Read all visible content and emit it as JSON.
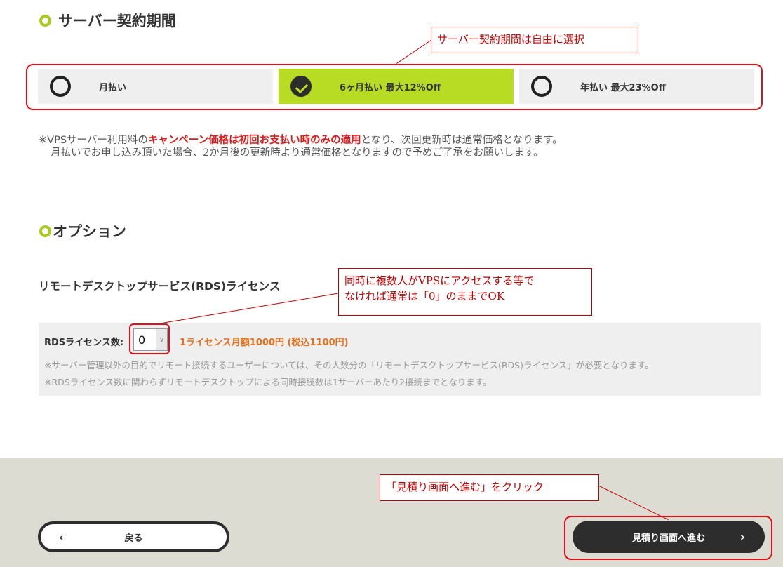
{
  "contract": {
    "title": "サーバー契約期間",
    "plans": [
      {
        "label": "月払い",
        "selected": false
      },
      {
        "label": "6ヶ月払い 最大12%Off",
        "selected": true
      },
      {
        "label": "年払い 最大23%Off",
        "selected": false
      }
    ],
    "callout": "サーバー契約期間は自由に選択"
  },
  "note": {
    "prefix": "※VPSサーバー利用料の",
    "highlight": "キャンペーン価格は初回お支払い時のみの適用",
    "suffix": "となり、次回更新時は通常価格となります。",
    "line2": "月払いでお申し込み頂いた場合、2か月後の更新時より通常価格となりますので予めご了承をお願いします。"
  },
  "option": {
    "title": "オプション",
    "rds_heading": "リモートデスクトップサービス(RDS)ライセンス",
    "rds_label": "RDSライセンス数:",
    "rds_value": "0",
    "rds_price": "1ライセンス月額1000円 (税込1100円)",
    "rds_note1": "※サーバー管理以外の目的でリモート接続するユーザーについては、その人数分の「リモートデスクトップサービス(RDS)ライセンス」が必要となります。",
    "rds_note2": "※RDSライセンス数に関わらずリモートデスクトップによる同時接続数は1サーバーあたり2接続までとなります。",
    "callout_line1": "同時に複数人がVPSにアクセスする等で",
    "callout_line2": "なければ通常は「0」のままでOK"
  },
  "footer": {
    "back_label": "戻る",
    "next_label": "見積り画面へ進む",
    "callout": "「見積り画面へ進む」をクリック"
  },
  "colors": {
    "accent": "#b8dc24",
    "annotation": "#c00000",
    "highlight": "#e01818",
    "price": "#e8701a"
  }
}
